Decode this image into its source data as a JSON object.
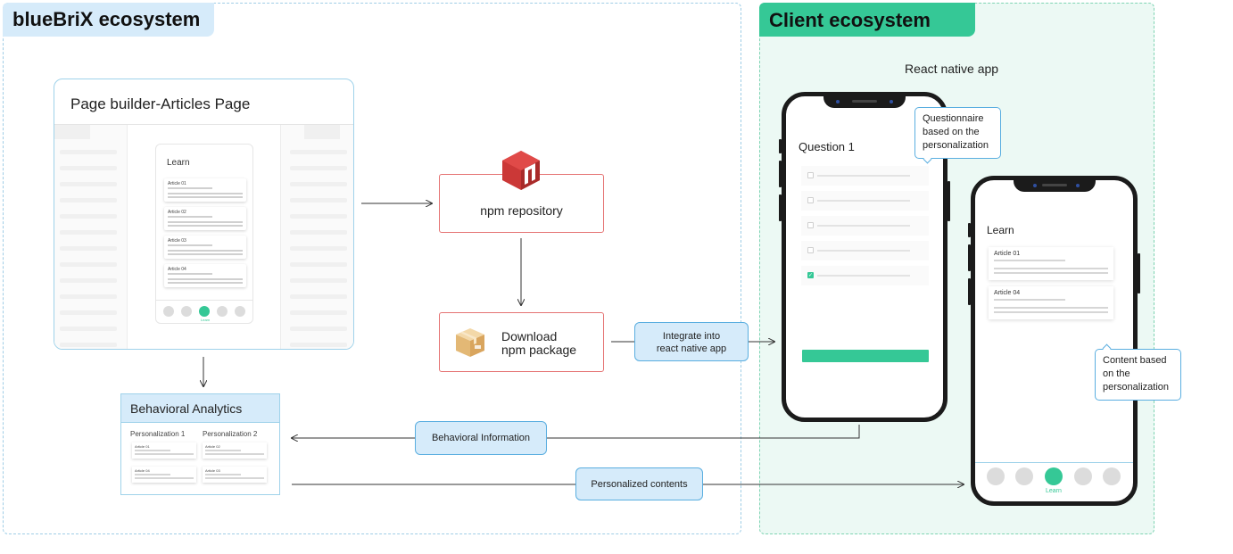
{
  "bluebrix": {
    "title": "blueBriX ecosystem"
  },
  "client": {
    "title": "Client ecosystem",
    "subtitle": "React native app"
  },
  "page_builder": {
    "title": "Page builder-Articles Page",
    "preview_title": "Learn",
    "articles": [
      "Article 01",
      "Article 02",
      "Article 03",
      "Article 04"
    ],
    "nav_active_label": "Learn"
  },
  "npm": {
    "repository_label": "npm repository",
    "download_line1": "Download",
    "download_line2": "npm package"
  },
  "analytics": {
    "title": "Behavioral Analytics",
    "personalization_1": "Personalization 1",
    "personalization_2": "Personalization 2",
    "cards_1": [
      "Article 01",
      "Article 04"
    ],
    "cards_2": [
      "Article 02",
      "Article 03"
    ]
  },
  "flows": {
    "integrate_line1": "Integrate into",
    "integrate_line2": "react native app",
    "behavioral_info": "Behavioral Information",
    "personalized": "Personalized contents"
  },
  "phone_question": {
    "title": "Question 1",
    "checked_index": 4
  },
  "phone_learn": {
    "title": "Learn",
    "articles": [
      "Article 01",
      "Article 04"
    ],
    "nav_label": "Learn"
  },
  "tips": {
    "questionnaire": [
      "Questionnaire",
      "based on the",
      "personalization"
    ],
    "content": [
      "Content based",
      "on the",
      "personalization"
    ]
  },
  "colors": {
    "accent_green": "#35c896",
    "light_blue": "#d6ebfa",
    "border_blue": "#5aaee0",
    "npm_red": "#cb3837"
  }
}
